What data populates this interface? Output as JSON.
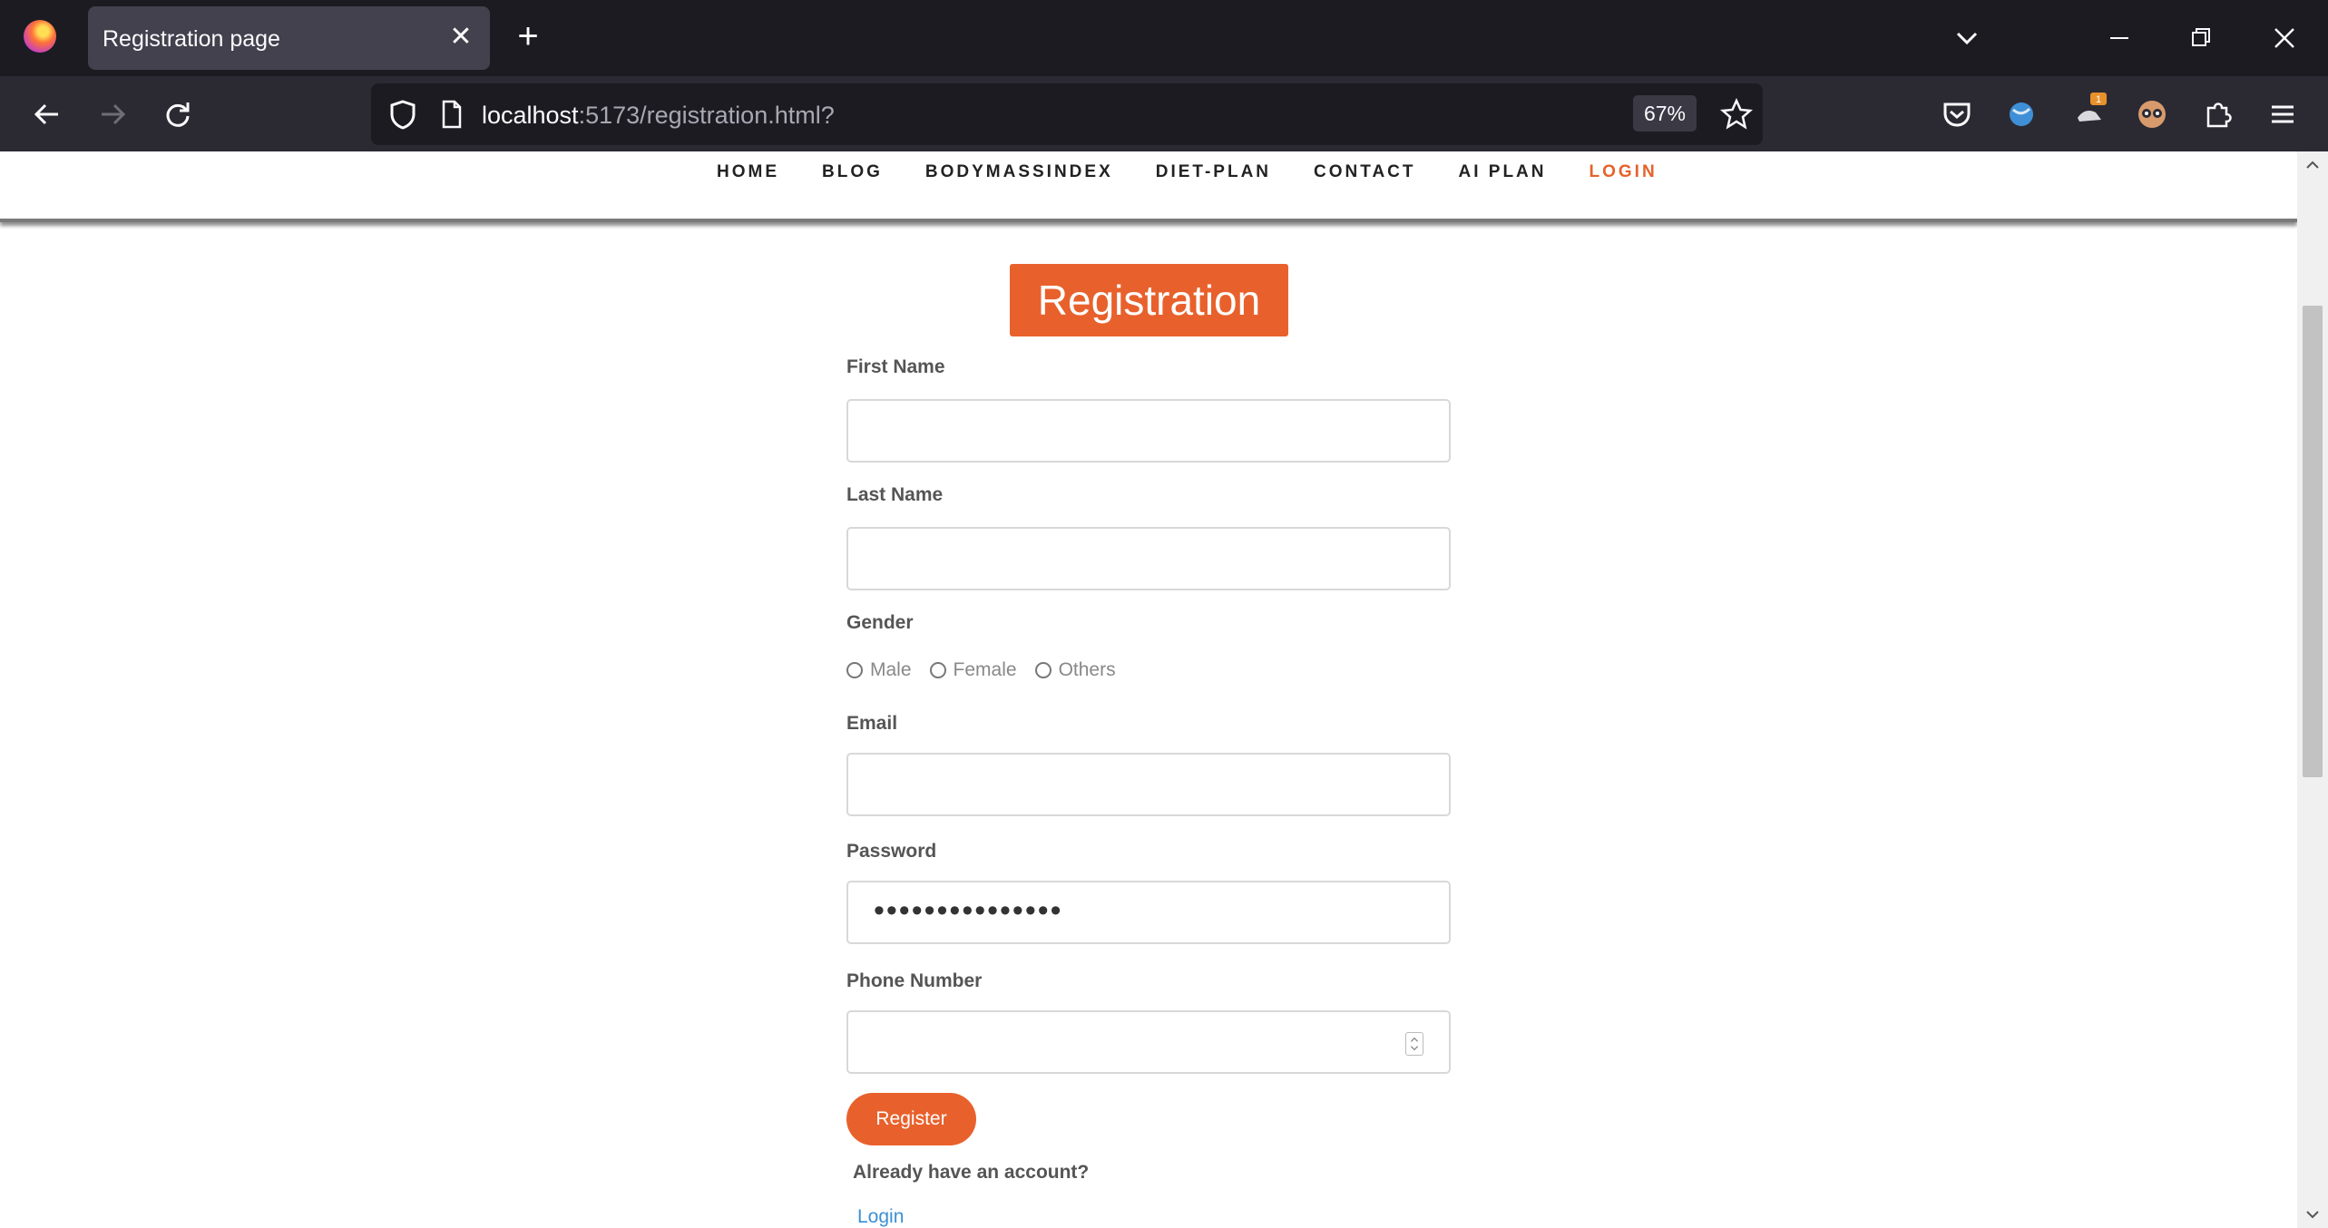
{
  "browser": {
    "tab_title": "Registration page",
    "tab_close": "✕",
    "new_tab": "+",
    "url_host": "localhost",
    "url_rest": ":5173/registration.html?",
    "zoom": "67%"
  },
  "site_nav": {
    "items": [
      "HOME",
      "BLOG",
      "BODYMASSINDEX",
      "DIET-PLAN",
      "CONTACT",
      "AI PLAN",
      "LOGIN"
    ],
    "active": "LOGIN",
    "accent_color": "#e5622b"
  },
  "form": {
    "heading": "Registration",
    "first_name_label": "First Name",
    "last_name_label": "Last Name",
    "gender_label": "Gender",
    "gender_options": [
      "Male",
      "Female",
      "Others"
    ],
    "email_label": "Email",
    "password_label": "Password",
    "password_dots": "•••••••••••••••",
    "phone_label": "Phone Number",
    "register_label": "Register",
    "already_text": "Already have an account?",
    "login_link": "Login",
    "button_color": "#e8612c"
  }
}
